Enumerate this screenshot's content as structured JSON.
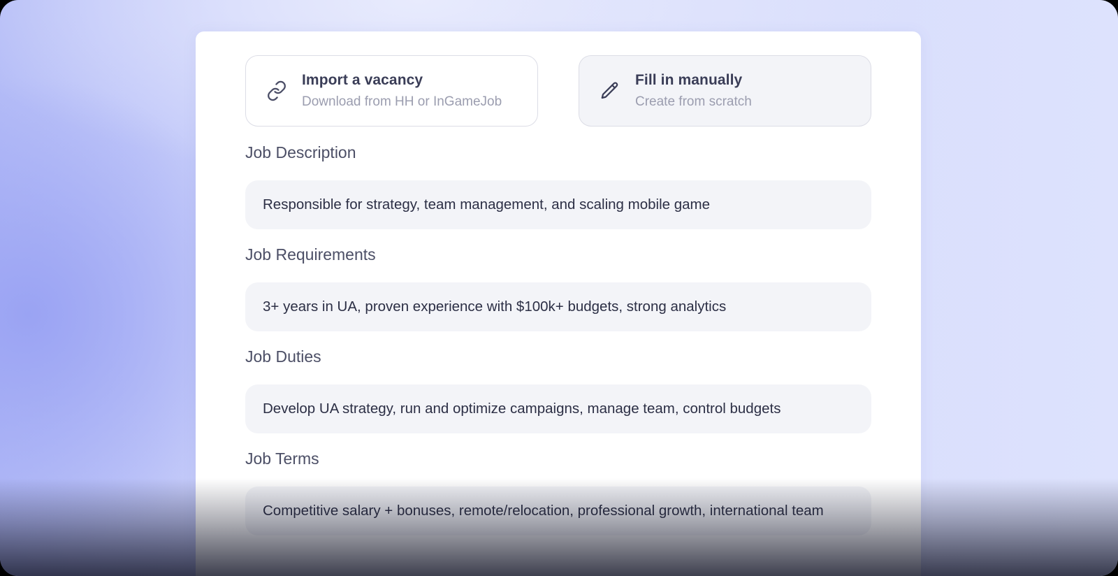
{
  "options": {
    "import": {
      "icon": "link-icon",
      "title": "Import a vacancy",
      "subtitle": "Download from HH or InGameJob"
    },
    "manual": {
      "icon": "pencil-icon",
      "title": "Fill in manually",
      "subtitle": "Create from scratch"
    }
  },
  "sections": {
    "description": {
      "label": "Job Description",
      "value": "Responsible for strategy, team management, and scaling mobile game"
    },
    "requirements": {
      "label": "Job Requirements",
      "value": "3+ years in UA, proven experience with $100k+ budgets, strong analytics"
    },
    "duties": {
      "label": "Job Duties",
      "value": "Develop UA strategy, run and optimize campaigns, manage team, control budgets"
    },
    "terms": {
      "label": "Job Terms",
      "value": "Competitive salary + bonuses, remote/relocation, professional growth, international team"
    }
  },
  "colors": {
    "background_accent": "#b4bcf7",
    "card": "#ffffff",
    "field": "#f3f4f8",
    "text_primary": "#2c2f45",
    "text_muted": "#9b9daf"
  }
}
